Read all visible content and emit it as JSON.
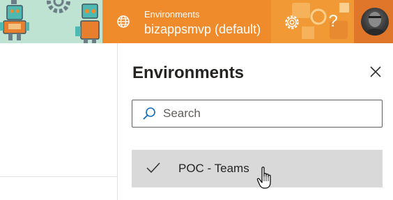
{
  "header": {
    "environment_label": "Environments",
    "environment_name": "bizappsmvp (default)",
    "help_label": "?",
    "icons": {
      "globe": "globe-icon",
      "settings": "gear-icon",
      "avatar": "user-avatar"
    },
    "colors": {
      "accent": "#F08B2C",
      "banner": "#BFE3D3"
    }
  },
  "panel": {
    "title": "Environments",
    "close_icon": "close-icon",
    "search": {
      "placeholder": "Search",
      "value": ""
    },
    "environments": [
      {
        "label": "POC - Teams",
        "selected": true
      }
    ]
  }
}
